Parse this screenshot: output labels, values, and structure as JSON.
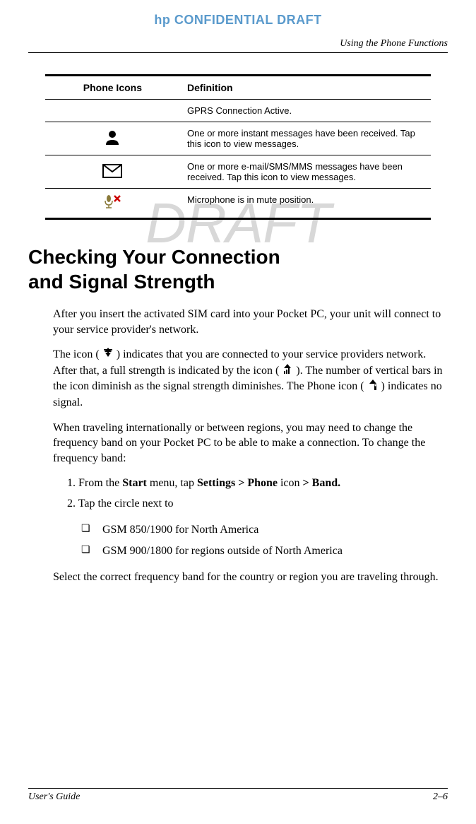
{
  "header": {
    "confidential": "hp CONFIDENTIAL DRAFT",
    "running": "Using the Phone Functions"
  },
  "watermark": "DRAFT",
  "table": {
    "headers": {
      "col1": "Phone Icons",
      "col2": "Definition"
    },
    "rows": [
      {
        "icon": "",
        "definition": "GPRS Connection Active."
      },
      {
        "icon": "person",
        "definition": "One or more instant messages have been received. Tap this icon to view messages."
      },
      {
        "icon": "envelope",
        "definition": "One or more e-mail/SMS/MMS messages have been received. Tap this icon to view messages."
      },
      {
        "icon": "mic-mute",
        "definition": "Microphone is in mute position."
      }
    ]
  },
  "section": {
    "heading_line1": "Checking Your Connection",
    "heading_line2": "and Signal Strength",
    "para1": "After you insert the activated SIM card into your Pocket PC, your unit will connect to your service provider's network.",
    "para2_a": "The icon (",
    "para2_b": ") indicates that you are connected to your service providers network. After that, a full strength is indicated by the icon (",
    "para2_c": "). The number of vertical bars in the icon diminish as the signal strength diminishes. The Phone icon (",
    "para2_d": ") indicates no signal.",
    "para3": "When traveling internationally or between regions, you may need to change the frequency band on your Pocket PC to be able to make a connection. To change the frequency band:",
    "step1_a": "1. From the ",
    "step1_b": "Start",
    "step1_c": " menu, tap ",
    "step1_d": "Settings > Phone",
    "step1_e": " icon ",
    "step1_f": "> Band.",
    "step2": "2. Tap the circle next to",
    "bullet1": "GSM 850/1900 for North America",
    "bullet2": "GSM 900/1800 for regions outside of North America",
    "para4": "Select the correct frequency band for the country or region you are traveling through."
  },
  "footer": {
    "left": "User's Guide",
    "right": "2–6"
  }
}
